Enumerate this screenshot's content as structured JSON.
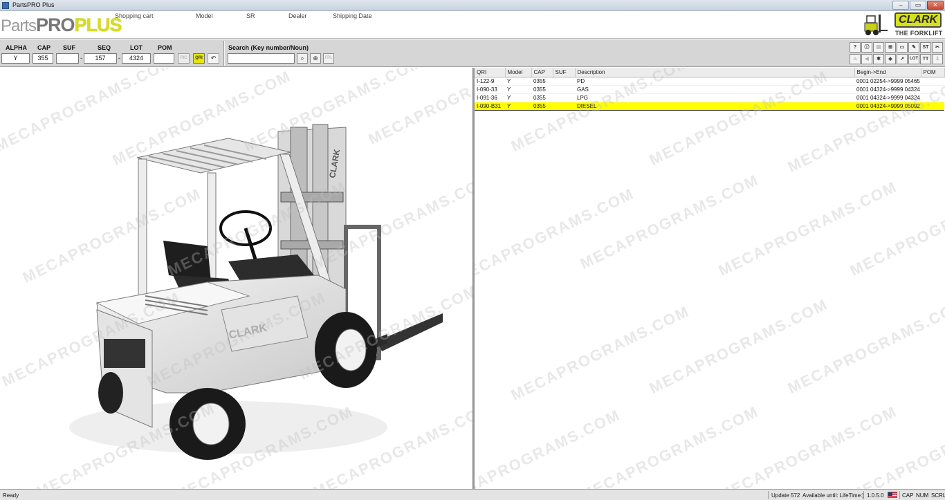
{
  "window": {
    "title": "PartsPRO Plus"
  },
  "app": {
    "logo": {
      "parts": "Parts",
      "pro": "PRO",
      "plus": "PLUS"
    },
    "menu": [
      "Shopping cart",
      "Model",
      "SR",
      "Dealer",
      "Shipping Date"
    ],
    "brand": {
      "name": "CLARK",
      "tagline": "THE FORKLIFT"
    }
  },
  "fields": {
    "alpha": {
      "label": "ALPHA",
      "value": "Y"
    },
    "cap": {
      "label": "CAP",
      "value": "355"
    },
    "suf": {
      "label": "SUF",
      "value": ""
    },
    "seq": {
      "label": "SEQ",
      "value": "157"
    },
    "lot": {
      "label": "LOT",
      "value": "4324"
    },
    "pom": {
      "label": "POM",
      "value": ""
    },
    "separator": "-"
  },
  "toolbar_buttons": {
    "pic": "PIC",
    "qri": "QRI",
    "fpl": "FPL",
    "st": "ST",
    "lot": "LOT",
    "tt": "TT"
  },
  "search": {
    "label": "Search (Key number/Noun)",
    "value": ""
  },
  "table": {
    "columns": [
      "QRI",
      "Model",
      "CAP",
      "SUF",
      "Description",
      "Begin->End",
      "POM"
    ],
    "rows": [
      {
        "qri": "I-122-9",
        "model": "Y",
        "cap": "0355",
        "suf": "",
        "description": "PD",
        "range": "0001 02254->9999 05465",
        "pom": ""
      },
      {
        "qri": "I-090-33",
        "model": "Y",
        "cap": "0355",
        "suf": "",
        "description": "GAS",
        "range": "0001 04324->9999 04324",
        "pom": ""
      },
      {
        "qri": "I-091-36",
        "model": "Y",
        "cap": "0355",
        "suf": "",
        "description": "LPG",
        "range": "0001 04324->9999 04324",
        "pom": ""
      },
      {
        "qri": "I-090-B31",
        "model": "Y",
        "cap": "0355",
        "suf": "",
        "description": "DIESEL",
        "range": "0001 04324->9999 05092",
        "pom": ""
      }
    ],
    "selected_row": 3
  },
  "image": {
    "decal": "CLARK"
  },
  "watermark": "MECAPROGRAMS.COM",
  "status": {
    "left": "Ready",
    "update": "Update 572",
    "available": "Available until: LifeTime:)",
    "version": "1.0.5.0",
    "cap": "CAP",
    "num": "NUM",
    "scrl": "SCRL"
  },
  "colors": {
    "accent_yellow": "#ffff00",
    "logo_green": "#d7de19"
  }
}
